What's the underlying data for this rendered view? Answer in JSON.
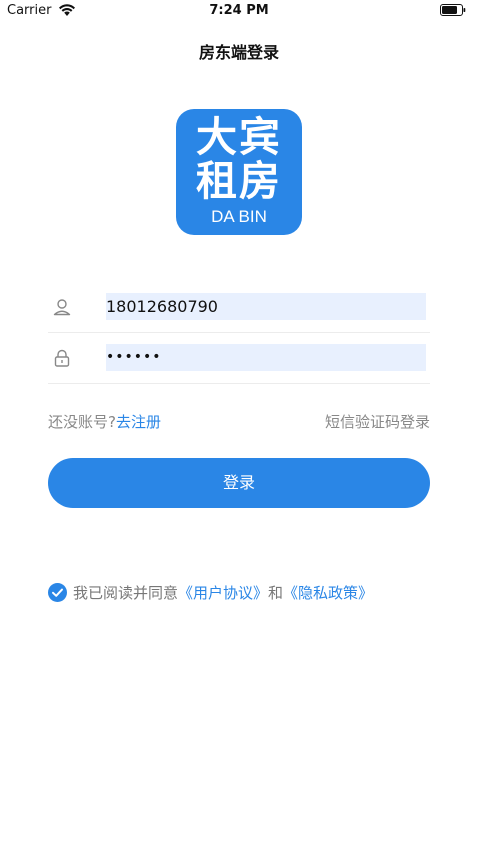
{
  "status_bar": {
    "carrier": "Carrier",
    "time": "7:24 PM",
    "wifi_icon": "wifi-icon",
    "battery_icon": "battery-icon"
  },
  "nav": {
    "title": "房东端登录"
  },
  "logo": {
    "line1": "大宾",
    "line2": "租房",
    "sub": "DA BIN",
    "color": "#2a86e6"
  },
  "form": {
    "phone": {
      "icon": "user-icon",
      "value": "18012680790"
    },
    "password": {
      "icon": "lock-icon",
      "masked_value": "••••••"
    }
  },
  "links": {
    "no_account": "还没账号?",
    "register": "去注册",
    "sms_login": "短信验证码登录"
  },
  "login_button": {
    "label": "登录"
  },
  "agreement": {
    "checked": true,
    "prefix": "我已阅读并同意",
    "user_agreement": "《用户协议》",
    "and": "和",
    "privacy_policy": "《隐私政策》"
  },
  "colors": {
    "accent": "#2a86e6",
    "input_bg": "#e8f0fe"
  }
}
